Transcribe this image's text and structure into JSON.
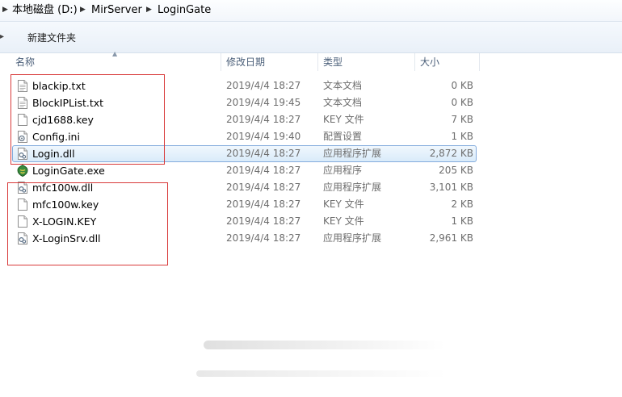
{
  "breadcrumb": {
    "items": [
      "本地磁盘 (D:)",
      "MirServer",
      "LoginGate"
    ]
  },
  "toolbar": {
    "new_folder_label": "新建文件夹"
  },
  "columns": {
    "name": "名称",
    "date": "修改日期",
    "type": "类型",
    "size": "大小"
  },
  "files": [
    {
      "name": "blackip.txt",
      "date": "2019/4/4 18:27",
      "type": "文本文档",
      "size": "0 KB",
      "icon": "text-file-icon"
    },
    {
      "name": "BlockIPList.txt",
      "date": "2019/4/4 19:45",
      "type": "文本文档",
      "size": "0 KB",
      "icon": "text-file-icon"
    },
    {
      "name": "cjd1688.key",
      "date": "2019/4/4 18:27",
      "type": "KEY 文件",
      "size": "7 KB",
      "icon": "blank-file-icon"
    },
    {
      "name": "Config.ini",
      "date": "2019/4/4 19:40",
      "type": "配置设置",
      "size": "1 KB",
      "icon": "config-file-icon"
    },
    {
      "name": "Login.dll",
      "date": "2019/4/4 18:27",
      "type": "应用程序扩展",
      "size": "2,872 KB",
      "icon": "dll-file-icon",
      "selected": true
    },
    {
      "name": "LoginGate.exe",
      "date": "2019/4/4 18:27",
      "type": "应用程序",
      "size": "205 KB",
      "icon": "exe-app-icon"
    },
    {
      "name": "mfc100w.dll",
      "date": "2019/4/4 18:27",
      "type": "应用程序扩展",
      "size": "3,101 KB",
      "icon": "dll-file-icon"
    },
    {
      "name": "mfc100w.key",
      "date": "2019/4/4 18:27",
      "type": "KEY 文件",
      "size": "2 KB",
      "icon": "blank-file-icon"
    },
    {
      "name": "X-LOGIN.KEY",
      "date": "2019/4/4 18:27",
      "type": "KEY 文件",
      "size": "1 KB",
      "icon": "blank-file-icon"
    },
    {
      "name": "X-LoginSrv.dll",
      "date": "2019/4/4 18:27",
      "type": "应用程序扩展",
      "size": "2,961 KB",
      "icon": "dll-file-icon"
    }
  ],
  "colors": {
    "annotation_red": "#d83a3a",
    "selection_border": "#84acdd",
    "header_text": "#4c607a"
  }
}
